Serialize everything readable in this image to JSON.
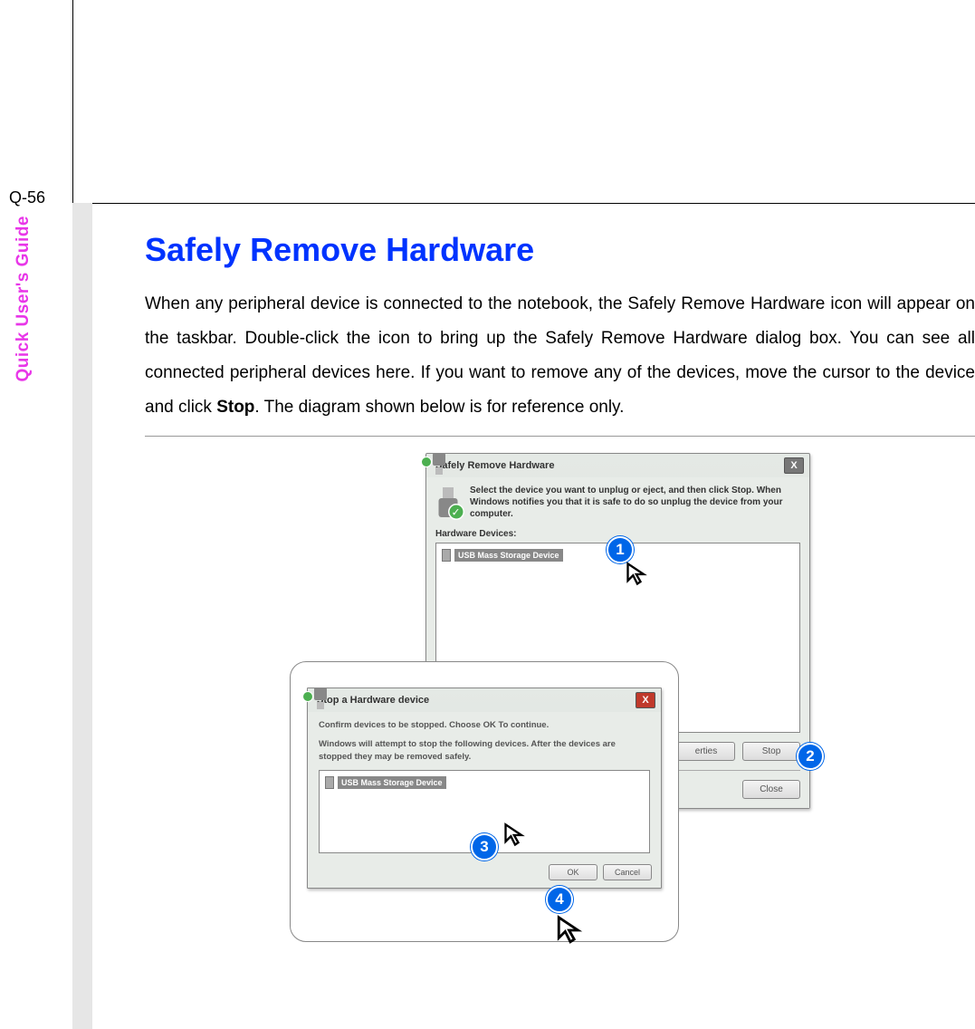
{
  "page_number": "Q-56",
  "sidebar_label": "Quick User's Guide",
  "title": "Safely Remove Hardware",
  "paragraph_parts": {
    "p1": "When any peripheral device is connected to the notebook, the Safely Remove Hardware icon will appear on the taskbar.   Double-click the icon to bring up the Safely Remove Hardware dialog box.   You can see all connected peripheral devices here.   If you want to remove any of the devices, move the cursor to the device and click ",
    "stop": "Stop",
    "p2": ".   The diagram shown below is for reference only."
  },
  "dialog1": {
    "title": "Safely Remove Hardware",
    "instruction": "Select the device you want to unplug or eject, and then click Stop. When Windows notifies you that it is safe to do so unplug the device from your computer.",
    "list_label": "Hardware Devices:",
    "device": "USB Mass Storage Device",
    "properties_btn": "erties",
    "stop_btn": "Stop",
    "close_btn": "Close"
  },
  "dialog2": {
    "title": "Stop a Hardware device",
    "line1": "Confirm devices to be stopped.  Choose OK To continue.",
    "line2": "Windows will attempt to stop the following devices. After the devices are stopped they may be removed safely.",
    "device": "USB Mass Storage Device",
    "ok_btn": "OK",
    "cancel_btn": "Cancel"
  },
  "badges": {
    "b1": "1",
    "b2": "2",
    "b3": "3",
    "b4": "4"
  }
}
